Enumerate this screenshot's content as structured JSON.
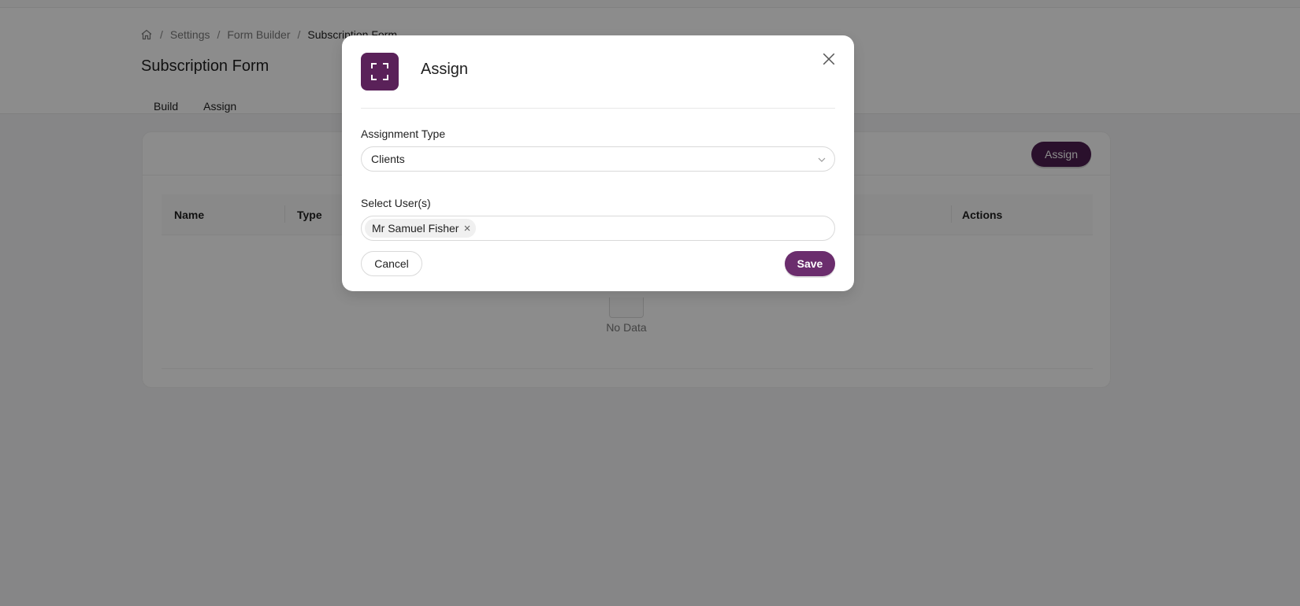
{
  "breadcrumb": {
    "home_icon": "home-icon",
    "items": [
      "Settings",
      "Form Builder",
      "Subscription Form"
    ],
    "separator": "/"
  },
  "page": {
    "title": "Subscription Form",
    "tabs": [
      {
        "label": "Build",
        "active": false
      },
      {
        "label": "Assign",
        "active": true
      }
    ]
  },
  "card": {
    "assign_button": "Assign",
    "columns": [
      "Name",
      "Type",
      "Actions"
    ],
    "empty_text": "No Data"
  },
  "modal": {
    "icon": "expand-icon",
    "title": "Assign",
    "close_icon": "close-icon",
    "assignment_type": {
      "label": "Assignment Type",
      "value": "Clients"
    },
    "select_users": {
      "label": "Select User(s)",
      "tags": [
        "Mr Samuel Fisher"
      ]
    },
    "cancel_label": "Cancel",
    "save_label": "Save"
  },
  "colors": {
    "brand": "#4e1e50",
    "save": "#6b2d6d",
    "icon_bg": "#5a2159"
  }
}
